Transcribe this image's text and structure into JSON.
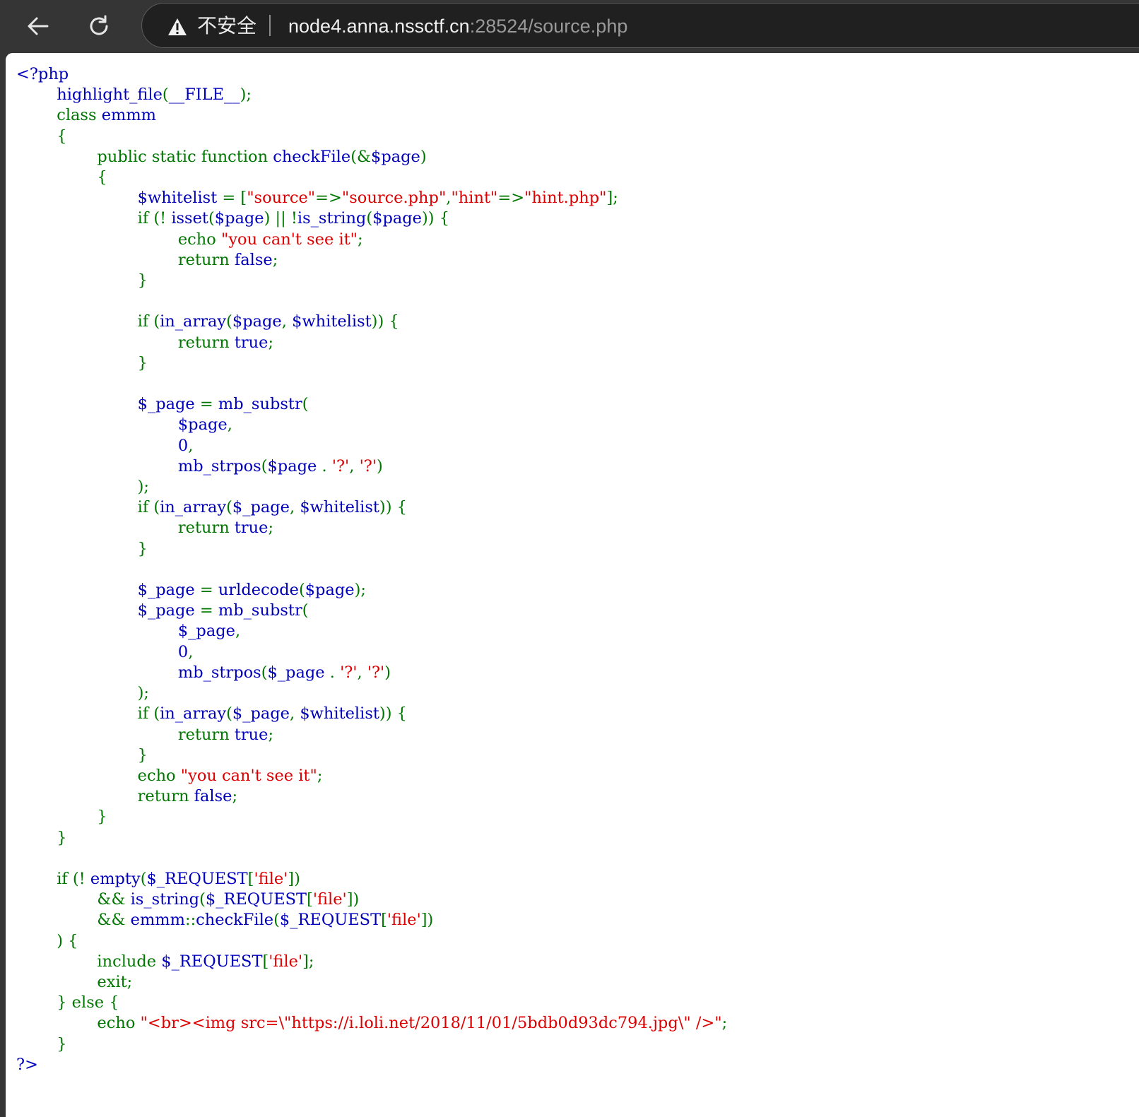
{
  "browser": {
    "security_label": "不安全",
    "url_host": "node4.anna.nssctf.cn",
    "url_rest": ":28524/source.php",
    "icons": [
      "back-arrow-icon",
      "reload-icon",
      "warning-triangle-icon"
    ]
  },
  "source": {
    "language": "php",
    "colors": {
      "default": "#0000BB",
      "keyword": "#007700",
      "string": "#DD0000",
      "html": "#000000"
    },
    "lines": [
      [
        [
          "d",
          "<?php"
        ]
      ],
      [
        [
          "d",
          "        highlight_file"
        ],
        [
          "k",
          "("
        ],
        [
          "d",
          "__FILE__"
        ],
        [
          "k",
          ");"
        ]
      ],
      [
        [
          "k",
          "        class "
        ],
        [
          "d",
          "emmm"
        ]
      ],
      [
        [
          "k",
          "        {"
        ]
      ],
      [
        [
          "k",
          "                public static function "
        ],
        [
          "d",
          "checkFile"
        ],
        [
          "k",
          "(&"
        ],
        [
          "d",
          "$page"
        ],
        [
          "k",
          ")"
        ]
      ],
      [
        [
          "k",
          "                {"
        ]
      ],
      [
        [
          "d",
          "                        $whitelist "
        ],
        [
          "k",
          "= ["
        ],
        [
          "s",
          "\"source\""
        ],
        [
          "k",
          "=>"
        ],
        [
          "s",
          "\"source.php\""
        ],
        [
          "k",
          ","
        ],
        [
          "s",
          "\"hint\""
        ],
        [
          "k",
          "=>"
        ],
        [
          "s",
          "\"hint.php\""
        ],
        [
          "k",
          "];"
        ]
      ],
      [
        [
          "k",
          "                        if (! "
        ],
        [
          "d",
          "isset"
        ],
        [
          "k",
          "("
        ],
        [
          "d",
          "$page"
        ],
        [
          "k",
          ") || !"
        ],
        [
          "d",
          "is_string"
        ],
        [
          "k",
          "("
        ],
        [
          "d",
          "$page"
        ],
        [
          "k",
          ")) {"
        ]
      ],
      [
        [
          "k",
          "                                echo "
        ],
        [
          "s",
          "\"you can't see it\""
        ],
        [
          "k",
          ";"
        ]
      ],
      [
        [
          "k",
          "                                return "
        ],
        [
          "d",
          "false"
        ],
        [
          "k",
          ";"
        ]
      ],
      [
        [
          "k",
          "                        }"
        ]
      ],
      [],
      [
        [
          "k",
          "                        if ("
        ],
        [
          "d",
          "in_array"
        ],
        [
          "k",
          "("
        ],
        [
          "d",
          "$page"
        ],
        [
          "k",
          ", "
        ],
        [
          "d",
          "$whitelist"
        ],
        [
          "k",
          ")) {"
        ]
      ],
      [
        [
          "k",
          "                                return "
        ],
        [
          "d",
          "true"
        ],
        [
          "k",
          ";"
        ]
      ],
      [
        [
          "k",
          "                        }"
        ]
      ],
      [],
      [
        [
          "d",
          "                        $_page "
        ],
        [
          "k",
          "= "
        ],
        [
          "d",
          "mb_substr"
        ],
        [
          "k",
          "("
        ]
      ],
      [
        [
          "d",
          "                                $page"
        ],
        [
          "k",
          ","
        ]
      ],
      [
        [
          "d",
          "                                0"
        ],
        [
          "k",
          ","
        ]
      ],
      [
        [
          "d",
          "                                mb_strpos"
        ],
        [
          "k",
          "("
        ],
        [
          "d",
          "$page "
        ],
        [
          "k",
          ". "
        ],
        [
          "s",
          "'?'"
        ],
        [
          "k",
          ", "
        ],
        [
          "s",
          "'?'"
        ],
        [
          "k",
          ")"
        ]
      ],
      [
        [
          "k",
          "                        );"
        ]
      ],
      [
        [
          "k",
          "                        if ("
        ],
        [
          "d",
          "in_array"
        ],
        [
          "k",
          "("
        ],
        [
          "d",
          "$_page"
        ],
        [
          "k",
          ", "
        ],
        [
          "d",
          "$whitelist"
        ],
        [
          "k",
          ")) {"
        ]
      ],
      [
        [
          "k",
          "                                return "
        ],
        [
          "d",
          "true"
        ],
        [
          "k",
          ";"
        ]
      ],
      [
        [
          "k",
          "                        }"
        ]
      ],
      [],
      [
        [
          "d",
          "                        $_page "
        ],
        [
          "k",
          "= "
        ],
        [
          "d",
          "urldecode"
        ],
        [
          "k",
          "("
        ],
        [
          "d",
          "$page"
        ],
        [
          "k",
          ");"
        ]
      ],
      [
        [
          "d",
          "                        $_page "
        ],
        [
          "k",
          "= "
        ],
        [
          "d",
          "mb_substr"
        ],
        [
          "k",
          "("
        ]
      ],
      [
        [
          "d",
          "                                $_page"
        ],
        [
          "k",
          ","
        ]
      ],
      [
        [
          "d",
          "                                0"
        ],
        [
          "k",
          ","
        ]
      ],
      [
        [
          "d",
          "                                mb_strpos"
        ],
        [
          "k",
          "("
        ],
        [
          "d",
          "$_page "
        ],
        [
          "k",
          ". "
        ],
        [
          "s",
          "'?'"
        ],
        [
          "k",
          ", "
        ],
        [
          "s",
          "'?'"
        ],
        [
          "k",
          ")"
        ]
      ],
      [
        [
          "k",
          "                        );"
        ]
      ],
      [
        [
          "k",
          "                        if ("
        ],
        [
          "d",
          "in_array"
        ],
        [
          "k",
          "("
        ],
        [
          "d",
          "$_page"
        ],
        [
          "k",
          ", "
        ],
        [
          "d",
          "$whitelist"
        ],
        [
          "k",
          ")) {"
        ]
      ],
      [
        [
          "k",
          "                                return "
        ],
        [
          "d",
          "true"
        ],
        [
          "k",
          ";"
        ]
      ],
      [
        [
          "k",
          "                        }"
        ]
      ],
      [
        [
          "k",
          "                        echo "
        ],
        [
          "s",
          "\"you can't see it\""
        ],
        [
          "k",
          ";"
        ]
      ],
      [
        [
          "k",
          "                        return "
        ],
        [
          "d",
          "false"
        ],
        [
          "k",
          ";"
        ]
      ],
      [
        [
          "k",
          "                }"
        ]
      ],
      [
        [
          "k",
          "        }"
        ]
      ],
      [],
      [
        [
          "k",
          "        if (! "
        ],
        [
          "d",
          "empty"
        ],
        [
          "k",
          "("
        ],
        [
          "d",
          "$_REQUEST"
        ],
        [
          "k",
          "["
        ],
        [
          "s",
          "'file'"
        ],
        [
          "k",
          "])"
        ]
      ],
      [
        [
          "k",
          "                && "
        ],
        [
          "d",
          "is_string"
        ],
        [
          "k",
          "("
        ],
        [
          "d",
          "$_REQUEST"
        ],
        [
          "k",
          "["
        ],
        [
          "s",
          "'file'"
        ],
        [
          "k",
          "])"
        ]
      ],
      [
        [
          "k",
          "                && "
        ],
        [
          "d",
          "emmm"
        ],
        [
          "k",
          "::"
        ],
        [
          "d",
          "checkFile"
        ],
        [
          "k",
          "("
        ],
        [
          "d",
          "$_REQUEST"
        ],
        [
          "k",
          "["
        ],
        [
          "s",
          "'file'"
        ],
        [
          "k",
          "])"
        ]
      ],
      [
        [
          "k",
          "        ) {"
        ]
      ],
      [
        [
          "k",
          "                include "
        ],
        [
          "d",
          "$_REQUEST"
        ],
        [
          "k",
          "["
        ],
        [
          "s",
          "'file'"
        ],
        [
          "k",
          "];"
        ]
      ],
      [
        [
          "k",
          "                exit;"
        ]
      ],
      [
        [
          "k",
          "        } else {"
        ]
      ],
      [
        [
          "k",
          "                echo "
        ],
        [
          "s",
          "\"<br><img src=\\\"https://i.loli.net/2018/11/01/5bdb0d93dc794.jpg\\\" />\""
        ],
        [
          "k",
          ";"
        ]
      ],
      [
        [
          "k",
          "        }"
        ]
      ],
      [
        [
          "d",
          "?>"
        ]
      ]
    ]
  }
}
